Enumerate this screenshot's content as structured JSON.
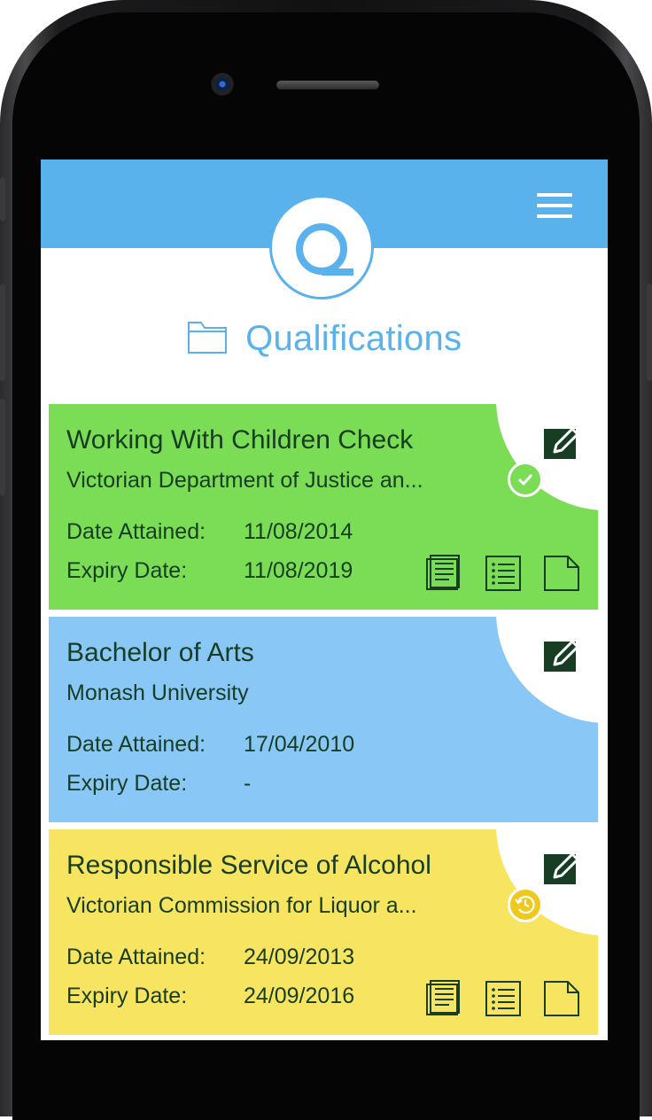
{
  "header": {
    "menu_icon": "hamburger-menu-icon",
    "logo_icon": "q-logo-icon",
    "title": "Qualifications",
    "title_icon": "folder-icon"
  },
  "colors": {
    "header_blue": "#5ab2ec",
    "valid_green": "#7bdc55",
    "no_expiry_blue": "#89c7f6",
    "expiring_yellow": "#f7e460",
    "text_dark_green": "#173d22"
  },
  "qualifications": [
    {
      "title": "Working With Children Check",
      "organisation": "Victorian Department of Justice an...",
      "date_attained_label": "Date Attained:",
      "date_attained": "11/08/2014",
      "expiry_label": "Expiry Date:",
      "expiry_date": "11/08/2019",
      "status_icon": "check-circle-icon",
      "actions": [
        "edit-icon",
        "document-lines-icon",
        "checklist-icon",
        "blank-page-icon"
      ]
    },
    {
      "title": "Bachelor of Arts",
      "organisation": "Monash University",
      "date_attained_label": "Date Attained:",
      "date_attained": "17/04/2010",
      "expiry_label": "Expiry Date:",
      "expiry_date": "-",
      "actions": [
        "edit-icon"
      ]
    },
    {
      "title": "Responsible Service of Alcohol",
      "organisation": "Victorian Commission for Liquor a...",
      "date_attained_label": "Date Attained:",
      "date_attained": "24/09/2013",
      "expiry_label": "Expiry Date:",
      "expiry_date": "24/09/2016",
      "status_icon": "clock-history-icon",
      "actions": [
        "edit-icon",
        "document-lines-icon",
        "checklist-icon",
        "blank-page-icon"
      ]
    }
  ]
}
